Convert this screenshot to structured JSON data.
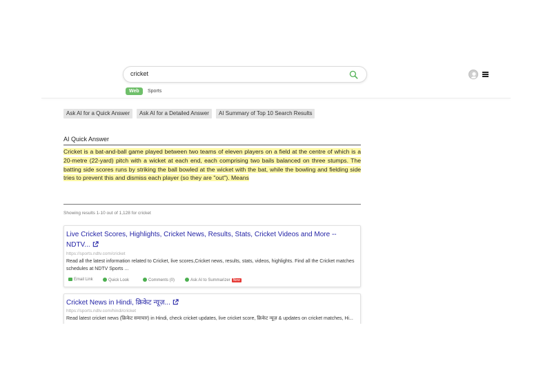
{
  "search": {
    "query": "cricket"
  },
  "tabs": [
    {
      "label": "Web"
    },
    {
      "label": "Sports"
    }
  ],
  "ai_buttons": [
    {
      "label": "Ask AI for a Quick Answer"
    },
    {
      "label": "Ask AI for a Detailed Answer"
    },
    {
      "label": "AI Summary of Top 10 Search Results"
    }
  ],
  "ai_quick": {
    "title": "AI Quick Answer",
    "answer": "Cricket is a bat-and-ball game played between two teams of eleven players on a field at the centre of which is a 20-metre (22-yard) pitch with a wicket at each end, each comprising two bails balanced on three stumps. The batting side scores runs by striking the ball bowled at the wicket with the bat, while the bowling and fielding side tries to prevent this and dismiss each player (so they are \"out\"). Means"
  },
  "results_summary": "Showing results 1-10 out of 1,128 for cricket",
  "results": [
    {
      "title": "Live Cricket Scores, Highlights, Cricket News, Results, Stats, Cricket Videos and More -- NDTV...",
      "url": "https://sports.ndtv.com/cricket",
      "description": "Read all the latest information related to Cricket, live scores,Cricket news, results, stats, videos, highlights. Find all the Cricket matches schedules at NDTV Sports ..."
    },
    {
      "title": "Cricket News in Hindi, क्रिकेट न्यूज़...",
      "url": "https://sports.ndtv.com/hindi/cricket",
      "description": "Read latest cricket news (क्रिकेट समाचार) in Hindi, check cricket updates, live cricket score, क्रिकेट न्यूज़ & updates on cricket matches, Hi..."
    }
  ],
  "result_actions": {
    "email": "Email Link",
    "quick_look": "Quick Look",
    "comments": "Comments (0)",
    "summarizer": "Ask AI to Summarizer",
    "new_badge": "New"
  },
  "colors": {
    "accent_green": "#6fbf6a",
    "link_blue": "#2424a6",
    "highlight": "#fff9a8"
  }
}
